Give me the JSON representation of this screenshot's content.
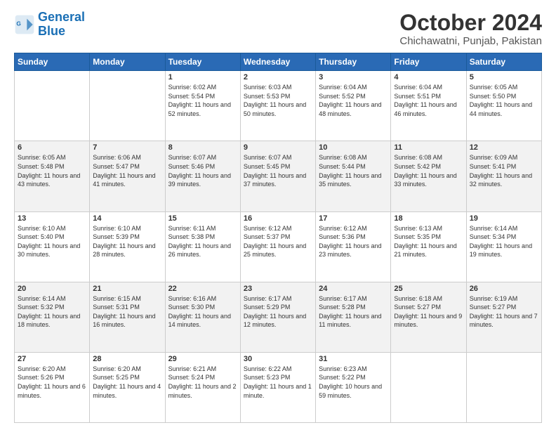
{
  "logo": {
    "text_general": "General",
    "text_blue": "Blue"
  },
  "header": {
    "title": "October 2024",
    "subtitle": "Chichawatni, Punjab, Pakistan"
  },
  "weekdays": [
    "Sunday",
    "Monday",
    "Tuesday",
    "Wednesday",
    "Thursday",
    "Friday",
    "Saturday"
  ],
  "weeks": [
    [
      {
        "day": "",
        "sunrise": "",
        "sunset": "",
        "daylight": ""
      },
      {
        "day": "",
        "sunrise": "",
        "sunset": "",
        "daylight": ""
      },
      {
        "day": "1",
        "sunrise": "Sunrise: 6:02 AM",
        "sunset": "Sunset: 5:54 PM",
        "daylight": "Daylight: 11 hours and 52 minutes."
      },
      {
        "day": "2",
        "sunrise": "Sunrise: 6:03 AM",
        "sunset": "Sunset: 5:53 PM",
        "daylight": "Daylight: 11 hours and 50 minutes."
      },
      {
        "day": "3",
        "sunrise": "Sunrise: 6:04 AM",
        "sunset": "Sunset: 5:52 PM",
        "daylight": "Daylight: 11 hours and 48 minutes."
      },
      {
        "day": "4",
        "sunrise": "Sunrise: 6:04 AM",
        "sunset": "Sunset: 5:51 PM",
        "daylight": "Daylight: 11 hours and 46 minutes."
      },
      {
        "day": "5",
        "sunrise": "Sunrise: 6:05 AM",
        "sunset": "Sunset: 5:50 PM",
        "daylight": "Daylight: 11 hours and 44 minutes."
      }
    ],
    [
      {
        "day": "6",
        "sunrise": "Sunrise: 6:05 AM",
        "sunset": "Sunset: 5:48 PM",
        "daylight": "Daylight: 11 hours and 43 minutes."
      },
      {
        "day": "7",
        "sunrise": "Sunrise: 6:06 AM",
        "sunset": "Sunset: 5:47 PM",
        "daylight": "Daylight: 11 hours and 41 minutes."
      },
      {
        "day": "8",
        "sunrise": "Sunrise: 6:07 AM",
        "sunset": "Sunset: 5:46 PM",
        "daylight": "Daylight: 11 hours and 39 minutes."
      },
      {
        "day": "9",
        "sunrise": "Sunrise: 6:07 AM",
        "sunset": "Sunset: 5:45 PM",
        "daylight": "Daylight: 11 hours and 37 minutes."
      },
      {
        "day": "10",
        "sunrise": "Sunrise: 6:08 AM",
        "sunset": "Sunset: 5:44 PM",
        "daylight": "Daylight: 11 hours and 35 minutes."
      },
      {
        "day": "11",
        "sunrise": "Sunrise: 6:08 AM",
        "sunset": "Sunset: 5:42 PM",
        "daylight": "Daylight: 11 hours and 33 minutes."
      },
      {
        "day": "12",
        "sunrise": "Sunrise: 6:09 AM",
        "sunset": "Sunset: 5:41 PM",
        "daylight": "Daylight: 11 hours and 32 minutes."
      }
    ],
    [
      {
        "day": "13",
        "sunrise": "Sunrise: 6:10 AM",
        "sunset": "Sunset: 5:40 PM",
        "daylight": "Daylight: 11 hours and 30 minutes."
      },
      {
        "day": "14",
        "sunrise": "Sunrise: 6:10 AM",
        "sunset": "Sunset: 5:39 PM",
        "daylight": "Daylight: 11 hours and 28 minutes."
      },
      {
        "day": "15",
        "sunrise": "Sunrise: 6:11 AM",
        "sunset": "Sunset: 5:38 PM",
        "daylight": "Daylight: 11 hours and 26 minutes."
      },
      {
        "day": "16",
        "sunrise": "Sunrise: 6:12 AM",
        "sunset": "Sunset: 5:37 PM",
        "daylight": "Daylight: 11 hours and 25 minutes."
      },
      {
        "day": "17",
        "sunrise": "Sunrise: 6:12 AM",
        "sunset": "Sunset: 5:36 PM",
        "daylight": "Daylight: 11 hours and 23 minutes."
      },
      {
        "day": "18",
        "sunrise": "Sunrise: 6:13 AM",
        "sunset": "Sunset: 5:35 PM",
        "daylight": "Daylight: 11 hours and 21 minutes."
      },
      {
        "day": "19",
        "sunrise": "Sunrise: 6:14 AM",
        "sunset": "Sunset: 5:34 PM",
        "daylight": "Daylight: 11 hours and 19 minutes."
      }
    ],
    [
      {
        "day": "20",
        "sunrise": "Sunrise: 6:14 AM",
        "sunset": "Sunset: 5:32 PM",
        "daylight": "Daylight: 11 hours and 18 minutes."
      },
      {
        "day": "21",
        "sunrise": "Sunrise: 6:15 AM",
        "sunset": "Sunset: 5:31 PM",
        "daylight": "Daylight: 11 hours and 16 minutes."
      },
      {
        "day": "22",
        "sunrise": "Sunrise: 6:16 AM",
        "sunset": "Sunset: 5:30 PM",
        "daylight": "Daylight: 11 hours and 14 minutes."
      },
      {
        "day": "23",
        "sunrise": "Sunrise: 6:17 AM",
        "sunset": "Sunset: 5:29 PM",
        "daylight": "Daylight: 11 hours and 12 minutes."
      },
      {
        "day": "24",
        "sunrise": "Sunrise: 6:17 AM",
        "sunset": "Sunset: 5:28 PM",
        "daylight": "Daylight: 11 hours and 11 minutes."
      },
      {
        "day": "25",
        "sunrise": "Sunrise: 6:18 AM",
        "sunset": "Sunset: 5:27 PM",
        "daylight": "Daylight: 11 hours and 9 minutes."
      },
      {
        "day": "26",
        "sunrise": "Sunrise: 6:19 AM",
        "sunset": "Sunset: 5:27 PM",
        "daylight": "Daylight: 11 hours and 7 minutes."
      }
    ],
    [
      {
        "day": "27",
        "sunrise": "Sunrise: 6:20 AM",
        "sunset": "Sunset: 5:26 PM",
        "daylight": "Daylight: 11 hours and 6 minutes."
      },
      {
        "day": "28",
        "sunrise": "Sunrise: 6:20 AM",
        "sunset": "Sunset: 5:25 PM",
        "daylight": "Daylight: 11 hours and 4 minutes."
      },
      {
        "day": "29",
        "sunrise": "Sunrise: 6:21 AM",
        "sunset": "Sunset: 5:24 PM",
        "daylight": "Daylight: 11 hours and 2 minutes."
      },
      {
        "day": "30",
        "sunrise": "Sunrise: 6:22 AM",
        "sunset": "Sunset: 5:23 PM",
        "daylight": "Daylight: 11 hours and 1 minute."
      },
      {
        "day": "31",
        "sunrise": "Sunrise: 6:23 AM",
        "sunset": "Sunset: 5:22 PM",
        "daylight": "Daylight: 10 hours and 59 minutes."
      },
      {
        "day": "",
        "sunrise": "",
        "sunset": "",
        "daylight": ""
      },
      {
        "day": "",
        "sunrise": "",
        "sunset": "",
        "daylight": ""
      }
    ]
  ]
}
